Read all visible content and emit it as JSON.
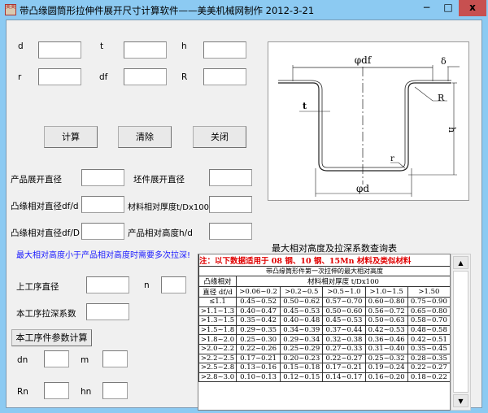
{
  "window": {
    "title": "带凸缘圆筒形拉伸件展开尺寸计算软件——美美机械网制作   2012-3-21",
    "icon_text": "美美",
    "minimize": "−",
    "maximize": "□",
    "close": "x"
  },
  "inputs": {
    "d": "d",
    "t": "t",
    "h": "h",
    "r": "r",
    "df": "df",
    "R": "R"
  },
  "buttons": {
    "calc": "计算",
    "clear": "清除",
    "close": "关闭",
    "step_calc": "本工序件参数计算"
  },
  "results": {
    "product_dia": "产品展开直径",
    "blank_dia": "坯件展开直径",
    "flange_ratio_d": "凸缘相对直径df/d",
    "thickness_ratio": "材料相对厚度t/Dx100",
    "flange_ratio_D": "凸缘相对直径df/D",
    "height_ratio": "产品相对高度h/d"
  },
  "warning": "最大相对高度小于产品相对高度时需要多次拉深!",
  "step": {
    "prev_dia": "上工序直径",
    "n": "n",
    "coef": "本工序拉深系数",
    "dn": "dn",
    "m": "m",
    "Rn": "Rn",
    "hn": "hn"
  },
  "drawing": {
    "df": "φdf",
    "delta": "δ",
    "R": "R",
    "t": "t",
    "h": "h",
    "r": "r",
    "d": "φd"
  },
  "table": {
    "title": "最大相对高度及拉深系数查询表",
    "note": "注：以下数据适用于 08 钢、10 钢、15Mn 材料及类似材料",
    "subtitle": "带凸缘筒形件第一次拉伸的最大相对高度",
    "row_header_1": "凸缘相对",
    "row_header_2": "直径 df/d",
    "col_group": "材料相对厚度 t/Dx100",
    "columns": [
      ">0.06~0.2",
      ">0.2~0.5",
      ">0.5~1.0",
      ">1.0~1.5",
      ">1.50"
    ],
    "rows": [
      [
        "≤1.1",
        "0.45~0.52",
        "0.50~0.62",
        "0.57~0.70",
        "0.60~0.80",
        "0.75~0.90"
      ],
      [
        ">1.1~1.3",
        "0.40~0.47",
        "0.45~0.53",
        "0.50~0.60",
        "0.56~0.72",
        "0.65~0.80"
      ],
      [
        ">1.3~1.5",
        "0.35~0.42",
        "0.40~0.48",
        "0.45~0.53",
        "0.50~0.63",
        "0.58~0.70"
      ],
      [
        ">1.5~1.8",
        "0.29~0.35",
        "0.34~0.39",
        "0.37~0.44",
        "0.42~0.53",
        "0.48~0.58"
      ],
      [
        ">1.8~2.0",
        "0.25~0.30",
        "0.29~0.34",
        "0.32~0.38",
        "0.36~0.46",
        "0.42~0.51"
      ],
      [
        ">2.0~2.2",
        "0.22~0.26",
        "0.25~0.29",
        "0.27~0.33",
        "0.31~0.40",
        "0.35~0.45"
      ],
      [
        ">2.2~2.5",
        "0.17~0.21",
        "0.20~0.23",
        "0.22~0.27",
        "0.25~0.32",
        "0.28~0.35"
      ],
      [
        ">2.5~2.8",
        "0.13~0.16",
        "0.15~0.18",
        "0.17~0.21",
        "0.19~0.24",
        "0.22~0.27"
      ],
      [
        ">2.8~3.0",
        "0.10~0.13",
        "0.12~0.15",
        "0.14~0.17",
        "0.16~0.20",
        "0.18~0.22"
      ]
    ]
  },
  "scroll": {
    "up": "▲",
    "down": "▼"
  },
  "colors": {
    "warning": "#1a1aff",
    "note": "#e00000",
    "close_btn": "#c75050"
  }
}
